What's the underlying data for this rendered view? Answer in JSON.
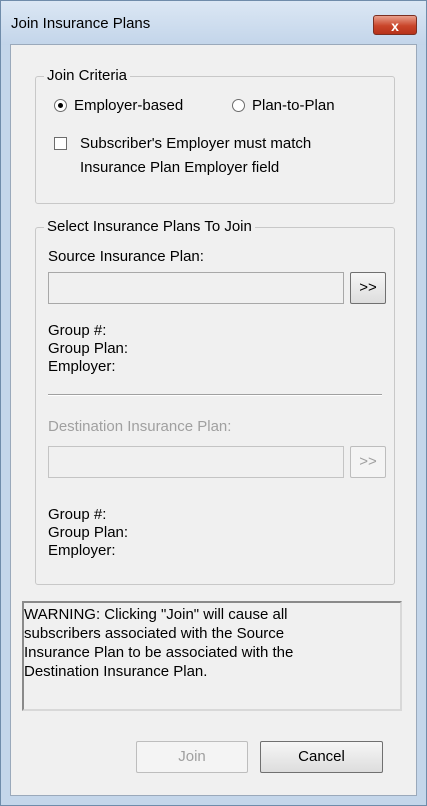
{
  "window": {
    "title": "Join Insurance Plans",
    "close_label": "x"
  },
  "join_criteria": {
    "legend": "Join Criteria",
    "radio_employer": {
      "label": "Employer-based",
      "checked": true
    },
    "radio_plan": {
      "label": "Plan-to-Plan",
      "checked": false
    },
    "checkbox_label_line1": "Subscriber's Employer must match",
    "checkbox_label_line2": "Insurance Plan Employer field",
    "checkbox_checked": false
  },
  "select_plans": {
    "legend": "Select Insurance Plans To Join",
    "source": {
      "label": "Source Insurance Plan:",
      "value": "",
      "browse_label": ">>",
      "group_number_label": "Group #:",
      "group_plan_label": "Group Plan:",
      "employer_label": "Employer:"
    },
    "destination": {
      "label": "Destination Insurance Plan:",
      "value": "",
      "browse_label": ">>",
      "group_number_label": "Group #:",
      "group_plan_label": "Group Plan:",
      "employer_label": "Employer:"
    }
  },
  "warning_text": "WARNING: Clicking \"Join\" will cause all\nsubscribers associated with the Source\nInsurance Plan to be associated with the\nDestination Insurance Plan.",
  "buttons": {
    "join": "Join",
    "cancel": "Cancel"
  }
}
